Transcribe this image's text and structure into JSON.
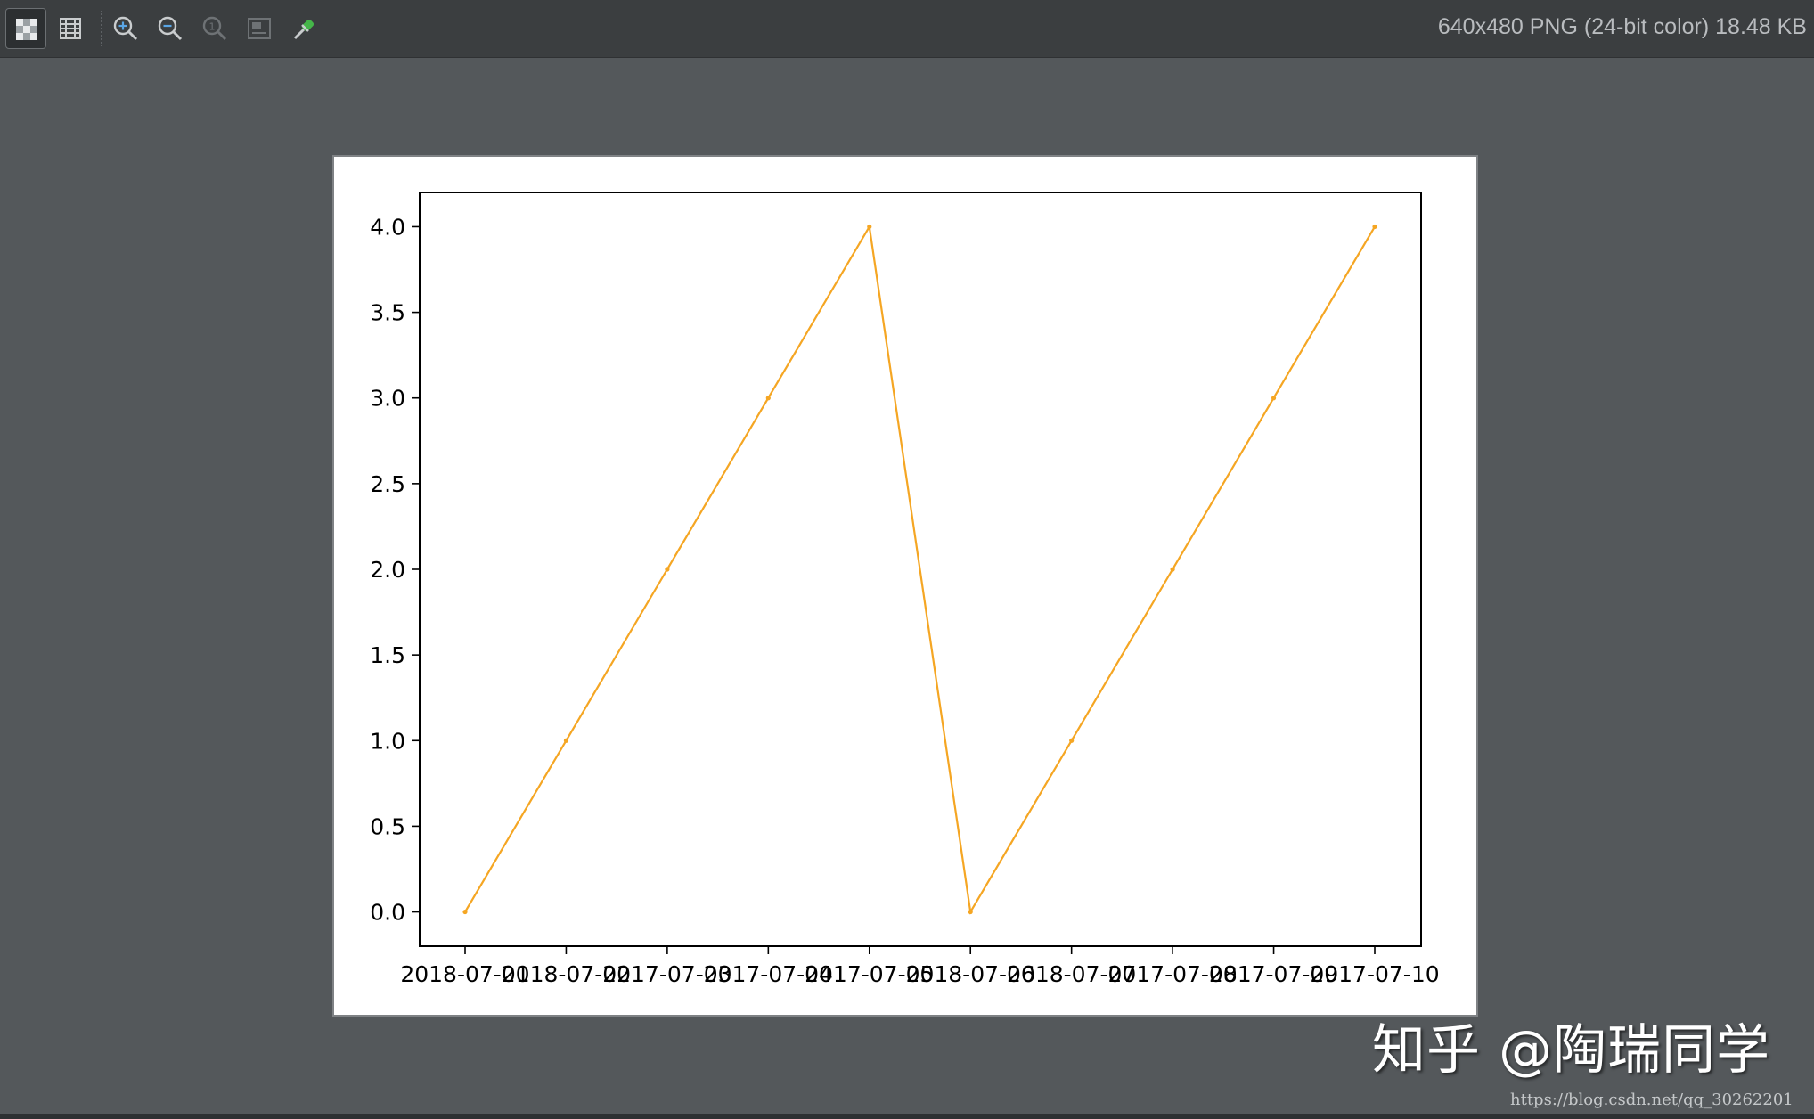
{
  "toolbar": {
    "buttons": [
      {
        "name": "chessboard-background-icon",
        "active": true
      },
      {
        "name": "grid-icon",
        "active": false
      },
      {
        "name": "zoom-in-icon",
        "active": false
      },
      {
        "name": "zoom-out-icon",
        "active": false
      },
      {
        "name": "actual-size-icon",
        "active": false
      },
      {
        "name": "fit-window-icon",
        "active": false
      },
      {
        "name": "color-picker-icon",
        "active": false
      }
    ],
    "image_info": "640x480 PNG (24-bit color) 18.48 KB"
  },
  "watermark": {
    "text": "知乎 @陶瑞同学",
    "url": "https://blog.csdn.net/qq_30262201"
  },
  "colors": {
    "line": "#f5a623",
    "accent_green": "#45b649"
  },
  "chart_data": {
    "type": "line",
    "categories": [
      "2018-07-01",
      "2018-07-02",
      "2017-07-03",
      "2017-07-04",
      "2017-07-05",
      "2018-07-06",
      "2018-07-07",
      "2017-07-08",
      "2017-07-09",
      "2017-07-10"
    ],
    "values": [
      0,
      1,
      2,
      3,
      4,
      0,
      1,
      2,
      3,
      4
    ],
    "ylim": [
      -0.2,
      4.2
    ],
    "yticks": [
      "0.0",
      "0.5",
      "1.0",
      "1.5",
      "2.0",
      "2.5",
      "3.0",
      "3.5",
      "4.0"
    ],
    "title": "",
    "xlabel": "",
    "ylabel": "",
    "grid": false,
    "marker": "point"
  }
}
